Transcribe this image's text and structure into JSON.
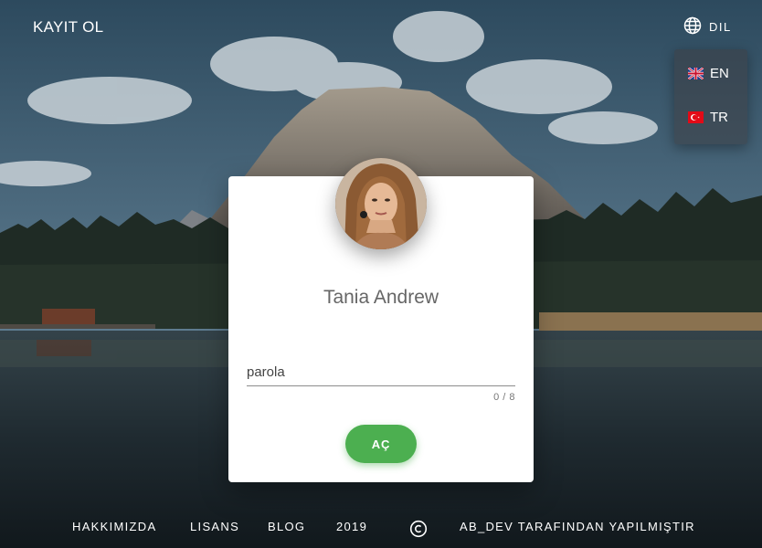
{
  "header": {
    "brand": "KAYIT OL",
    "language_toggle_label": "DIL"
  },
  "language_menu": [
    {
      "code": "EN",
      "icon": "uk-flag-icon"
    },
    {
      "code": "TR",
      "icon": "turkey-flag-icon"
    }
  ],
  "card": {
    "user_name": "Tania Andrew",
    "password_placeholder": "parola",
    "char_counter": "0 / 8",
    "open_button": "AÇ"
  },
  "footer": {
    "about": "HAKKIMIZDA",
    "license": "LISANS",
    "blog": "BLOG",
    "year": "2019",
    "copyright_icon": "copyright-icon",
    "credit": "AB_DEV TARAFINDAN YAPILMIŞTIR"
  },
  "colors": {
    "accent_green": "#4caf50",
    "card_bg": "#ffffff"
  }
}
